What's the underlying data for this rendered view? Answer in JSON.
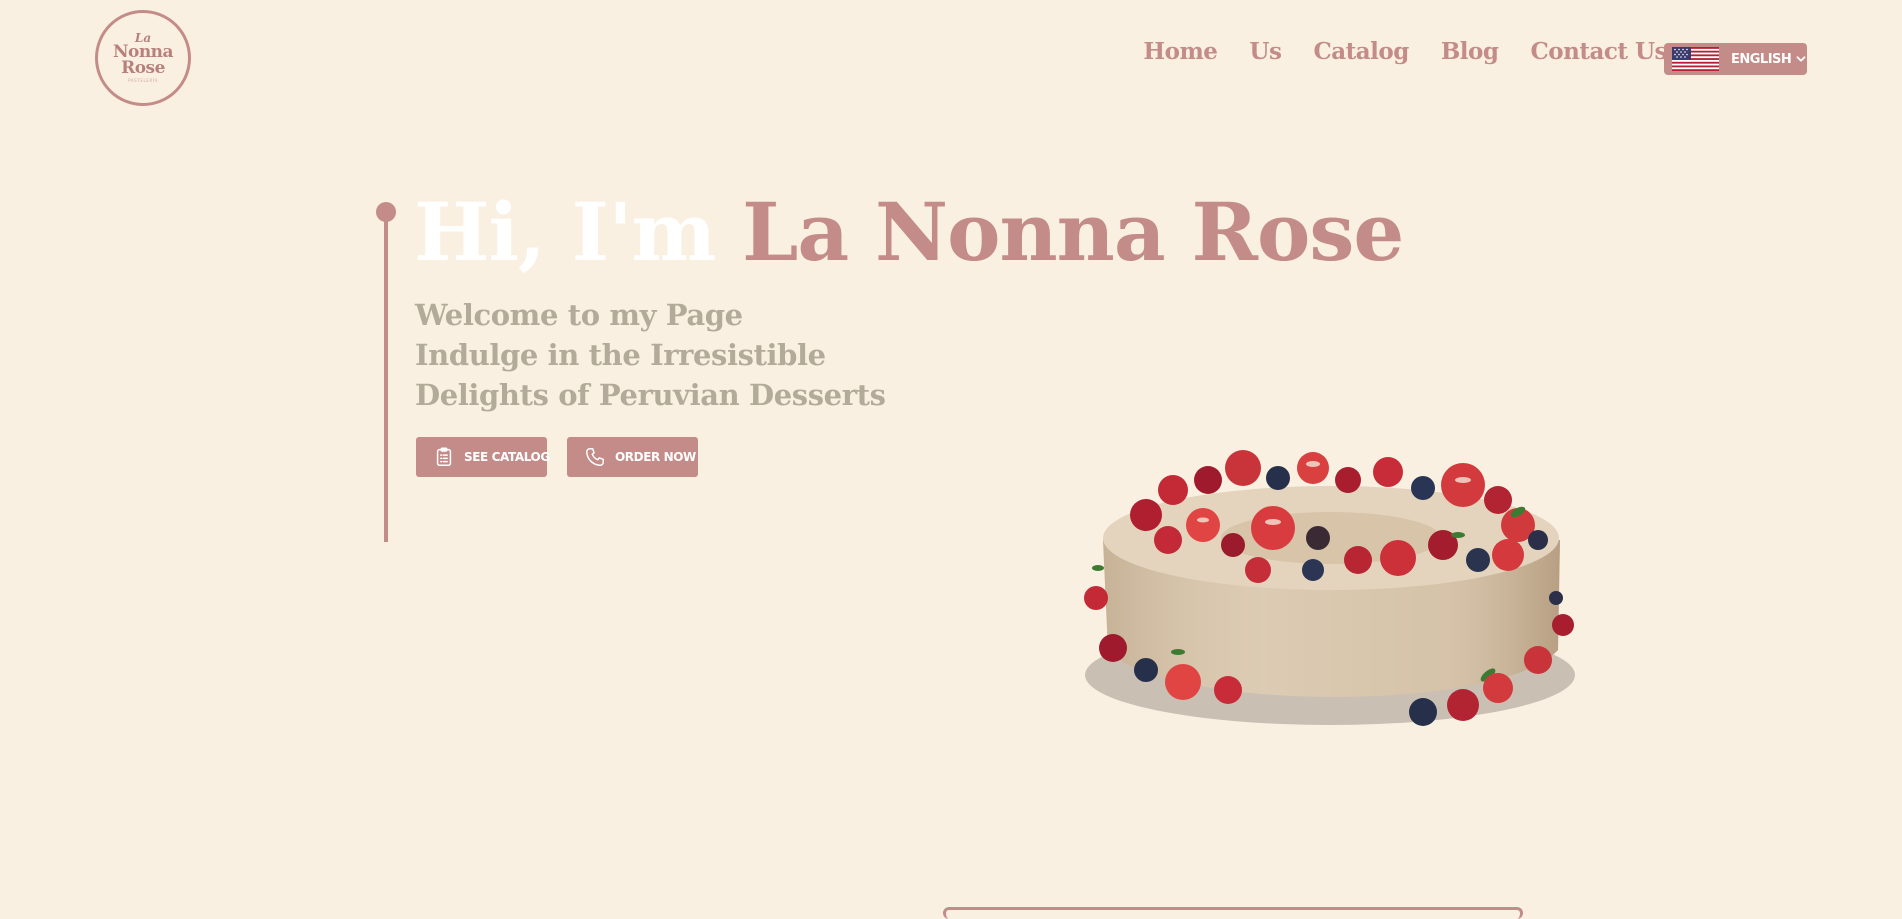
{
  "brand": {
    "logo_line1": "La",
    "logo_line2": "Nonna",
    "logo_line3": "Rose",
    "logo_tagline": "PASTELERÍA"
  },
  "nav": {
    "items": [
      {
        "label": "Home"
      },
      {
        "label": "Us"
      },
      {
        "label": "Catalog"
      },
      {
        "label": "Blog"
      },
      {
        "label": "Contact Us"
      }
    ]
  },
  "language": {
    "label": "ENGLISH",
    "flag_icon": "us-flag-icon"
  },
  "hero": {
    "greeting": "Hi, I'm ",
    "name": "La Nonna Rose",
    "subtitle_lines": [
      "Welcome to my Page",
      "Indulge in the Irresistible",
      "Delights of Peruvian Desserts"
    ],
    "buttons": {
      "catalog": "SEE CATALOG",
      "order": "ORDER NOW"
    }
  },
  "colors": {
    "background": "#faf0e2",
    "accent": "#c48c88",
    "subtitle": "#b3ab9a",
    "greeting": "#ffffff"
  }
}
